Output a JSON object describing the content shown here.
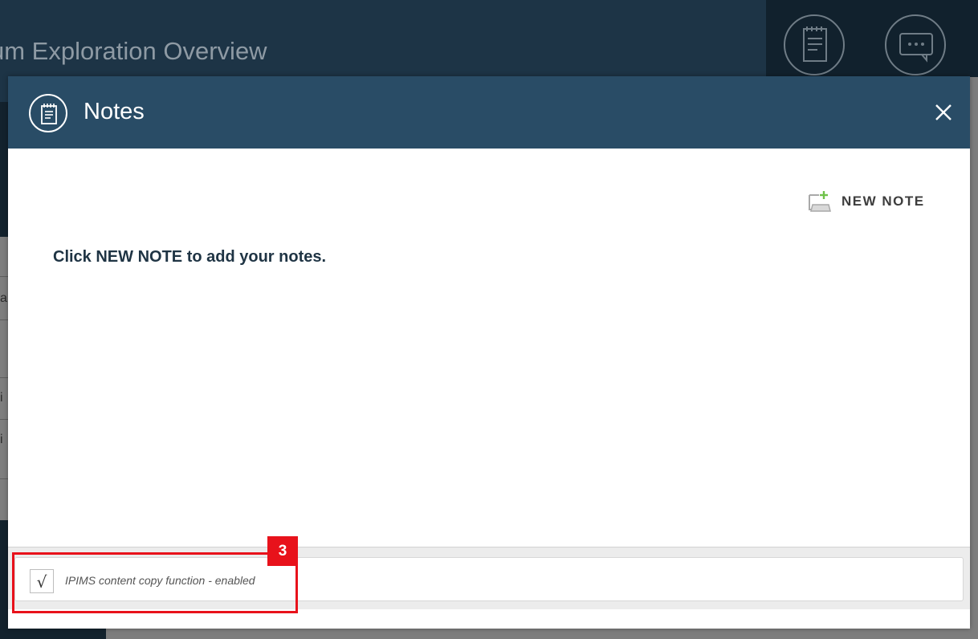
{
  "background": {
    "page_title": "um Exploration Overview",
    "side_letters": [
      "a",
      "i",
      "i"
    ]
  },
  "modal": {
    "title": "Notes",
    "icon": "notepad-icon",
    "close_icon": "close-icon",
    "new_note": {
      "label": "NEW NOTE",
      "icon": "new-note-icon"
    },
    "empty_hint": "Click NEW NOTE to add your notes.",
    "copy_function": {
      "checked": true,
      "check_glyph": "√",
      "label": "IPIMS content copy function - enabled"
    }
  },
  "annotation": {
    "badge": "3",
    "color": "#e8121b"
  },
  "colors": {
    "header": "#294c66",
    "page_header": "#1d3446",
    "accent_green": "#6fc24a"
  }
}
